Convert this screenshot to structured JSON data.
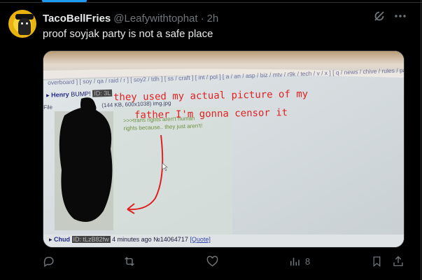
{
  "tweet": {
    "display_name": "TacoBellFries",
    "handle": "@Leafywithtophat",
    "separator": "·",
    "time": "2h",
    "text": "proof soyjak party is not a safe place"
  },
  "top_icons": [
    "grok-icon",
    "more-icon"
  ],
  "media": {
    "board_nav": "overboard ] [ soy / qa / raid / r ] [ soy2 / tdh ] [ ss / craft ] [ int / pol ] [ a / an / asp / biz / mtv / r9k / tech / v / x ] [ q / news / chive / rules / pass / bans ]",
    "post_name": "Henry",
    "post_bump": "BUMP!",
    "post_id": "ID: 3L",
    "file_label": "File",
    "file_meta": "(144 KB, 600x1038) img.jpg",
    "greentext_1": ">>>trans rights aren't human",
    "greentext_2": "rights because.. they just aren't!",
    "reply_name": "Chud",
    "reply_id": "ID: tLzB82fw",
    "reply_meta": "4 minutes ago №14064717",
    "reply_quote": "[Quote]",
    "annotation_line1": "they used my actual picture of my",
    "annotation_line2": "father I'm gonna censor it"
  },
  "actions": {
    "reply_count": "",
    "retweet_count": "",
    "like_count": "",
    "views_count": "8"
  },
  "colors": {
    "background": "#000000",
    "text": "#e7e9ea",
    "muted": "#71767b",
    "accent": "#1d9bf0",
    "annotation_red": "#e02020"
  }
}
